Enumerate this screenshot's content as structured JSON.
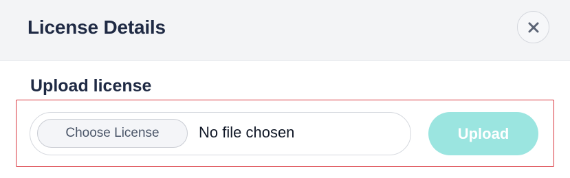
{
  "dialog": {
    "title": "License Details",
    "close_icon": "close-icon"
  },
  "upload": {
    "section_label": "Upload license",
    "choose_label": "Choose License",
    "file_status": "No file chosen",
    "upload_label": "Upload"
  },
  "colors": {
    "title_text": "#1f2a44",
    "header_bg": "#f3f4f6",
    "upload_button_bg": "#9be5e0",
    "highlight_border": "#d9363e"
  }
}
